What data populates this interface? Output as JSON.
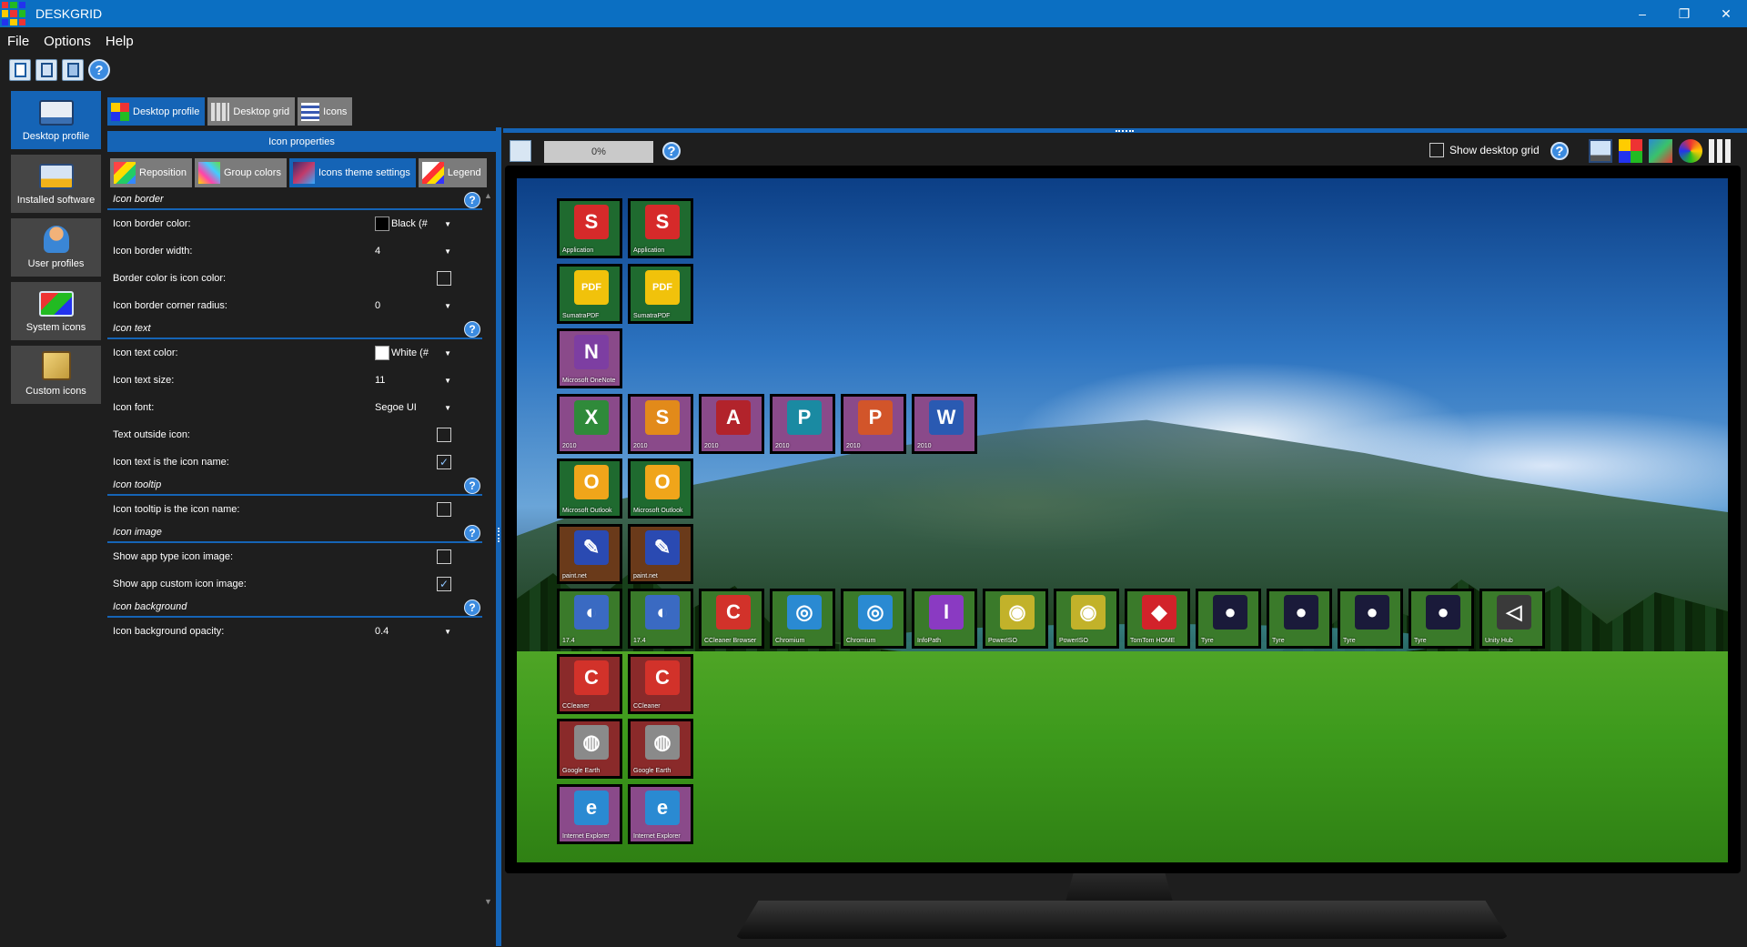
{
  "window": {
    "title": "DESKGRID",
    "controls": {
      "minimize": "–",
      "restore": "❐",
      "close": "✕"
    }
  },
  "menu": [
    "File",
    "Options",
    "Help"
  ],
  "toolbar": {
    "buttons": [
      "new-file-icon",
      "save-icon",
      "save-as-icon",
      "help-icon"
    ],
    "help_glyph": "?"
  },
  "nav": [
    {
      "label": "Desktop profile",
      "icon": "monitor-icon",
      "active": true
    },
    {
      "label": "Installed software",
      "icon": "software-icon",
      "active": false
    },
    {
      "label": "User profiles",
      "icon": "user-icon",
      "active": false
    },
    {
      "label": "System icons",
      "icon": "system-icon",
      "active": false
    },
    {
      "label": "Custom icons",
      "icon": "package-icon",
      "active": false
    }
  ],
  "main_tabs": [
    {
      "label": "Desktop profile",
      "active": true
    },
    {
      "label": "Desktop grid",
      "active": false
    },
    {
      "label": "Icons",
      "active": false
    }
  ],
  "props_header": "Icon properties",
  "sub_tabs": [
    {
      "label": "Reposition",
      "active": false
    },
    {
      "label": "Group colors",
      "active": false
    },
    {
      "label": "Icons theme settings",
      "active": true
    },
    {
      "label": "Legend",
      "active": false
    }
  ],
  "help_glyph": "?",
  "sections": {
    "border": "Icon border",
    "text": "Icon text",
    "tooltip": "Icon tooltip",
    "image": "Icon image",
    "background": "Icon background"
  },
  "props": {
    "border_color": {
      "label": "Icon border color:",
      "value": "Black (#"
    },
    "border_width": {
      "label": "Icon border width:",
      "value": "4"
    },
    "border_is_icon_color": {
      "label": "Border color is icon color:",
      "checked": false
    },
    "corner_radius": {
      "label": "Icon border corner radius:",
      "value": "0"
    },
    "text_color": {
      "label": "Icon text color:",
      "value": "White (#"
    },
    "text_size": {
      "label": "Icon text size:",
      "value": "11"
    },
    "font": {
      "label": "Icon font:",
      "value": "Segoe UI"
    },
    "text_outside": {
      "label": "Text outside icon:",
      "checked": false
    },
    "text_is_name": {
      "label": "Icon text is the icon name:",
      "checked": true
    },
    "tooltip_is_name": {
      "label": "Icon tooltip is the icon name:",
      "checked": false
    },
    "app_type_image": {
      "label": "Show app type icon image:",
      "checked": false
    },
    "custom_image": {
      "label": "Show app custom icon image:",
      "checked": true
    },
    "bg_opacity": {
      "label": "Icon background opacity:",
      "value": "0.4"
    }
  },
  "dropdown_arrow": "▼",
  "check_glyph": "✓",
  "right_panel": {
    "progress": "0%",
    "show_grid_label": "Show desktop grid",
    "show_grid_checked": false,
    "tool_icons": [
      "monitor-view-icon",
      "color-grid-icon",
      "shuffle-icon",
      "color-wheel-icon",
      "grid-icon"
    ]
  },
  "desktop_icons": [
    {
      "label": "Application",
      "glyph": "S",
      "color": "#d62a2a",
      "bg": "#1f6a2f"
    },
    {
      "label": "Application",
      "glyph": "S",
      "color": "#d62a2a",
      "bg": "#1f6a2f"
    },
    {
      "label": "SumatraPDF",
      "glyph": "PDF",
      "color": "#f1c20b",
      "bg": "#1f6a2f"
    },
    {
      "label": "SumatraPDF",
      "glyph": "PDF",
      "color": "#f1c20b",
      "bg": "#1f6a2f"
    },
    {
      "label": "Microsoft OneNote",
      "glyph": "N",
      "color": "#7d3ea2",
      "bg": "#8a4a8a"
    },
    {
      "label": "2010",
      "glyph": "X",
      "color": "#2f8a3a",
      "bg": "#8a4a8a"
    },
    {
      "label": "2010",
      "glyph": "S",
      "color": "#e28a1a",
      "bg": "#8a4a8a"
    },
    {
      "label": "2010",
      "glyph": "A",
      "color": "#b2232b",
      "bg": "#8a4a8a"
    },
    {
      "label": "2010",
      "glyph": "P",
      "color": "#1a8aa2",
      "bg": "#8a4a8a"
    },
    {
      "label": "2010",
      "glyph": "P",
      "color": "#d2552a",
      "bg": "#8a4a8a"
    },
    {
      "label": "2010",
      "glyph": "W",
      "color": "#2a5ab2",
      "bg": "#8a4a8a"
    },
    {
      "label": "Microsoft Outlook",
      "glyph": "O",
      "color": "#f0a51a",
      "bg": "#1f6a2f"
    },
    {
      "label": "Microsoft Outlook",
      "glyph": "O",
      "color": "#f0a51a",
      "bg": "#1f6a2f"
    },
    {
      "label": "paint.net",
      "glyph": "✎",
      "color": "#2a4ab2",
      "bg": "#6a3a1a"
    },
    {
      "label": "paint.net",
      "glyph": "✎",
      "color": "#2a4ab2",
      "bg": "#6a3a1a"
    },
    {
      "label": "17.4",
      "glyph": "◐",
      "color": "#3a6ac2",
      "bg": "#3a7a2a"
    },
    {
      "label": "17.4",
      "glyph": "◐",
      "color": "#3a6ac2",
      "bg": "#3a7a2a"
    },
    {
      "label": "CCleaner Browser",
      "glyph": "C",
      "color": "#d2322a",
      "bg": "#3a7a2a"
    },
    {
      "label": "Chromium",
      "glyph": "◎",
      "color": "#2a8ad2",
      "bg": "#3a7a2a"
    },
    {
      "label": "Chromium",
      "glyph": "◎",
      "color": "#2a8ad2",
      "bg": "#3a7a2a"
    },
    {
      "label": "InfoPath",
      "glyph": "I",
      "color": "#8a3ac2",
      "bg": "#3a7a2a"
    },
    {
      "label": "PowerISO",
      "glyph": "◉",
      "color": "#c2b22a",
      "bg": "#3a7a2a"
    },
    {
      "label": "PowerISO",
      "glyph": "◉",
      "color": "#c2b22a",
      "bg": "#3a7a2a"
    },
    {
      "label": "TomTom HOME",
      "glyph": "◆",
      "color": "#d2222a",
      "bg": "#3a7a2a"
    },
    {
      "label": "Tyre",
      "glyph": "●",
      "color": "#1a1a3a",
      "bg": "#3a7a2a"
    },
    {
      "label": "Tyre",
      "glyph": "●",
      "color": "#1a1a3a",
      "bg": "#3a7a2a"
    },
    {
      "label": "Tyre",
      "glyph": "●",
      "color": "#1a1a3a",
      "bg": "#3a7a2a"
    },
    {
      "label": "Tyre",
      "glyph": "●",
      "color": "#1a1a3a",
      "bg": "#3a7a2a"
    },
    {
      "label": "Unity Hub",
      "glyph": "◁",
      "color": "#3a3a3a",
      "bg": "#3a7a2a"
    },
    {
      "label": "CCleaner",
      "glyph": "C",
      "color": "#d2322a",
      "bg": "#8a2a2a"
    },
    {
      "label": "CCleaner",
      "glyph": "C",
      "color": "#d2322a",
      "bg": "#8a2a2a"
    },
    {
      "label": "Google Earth",
      "glyph": "◍",
      "color": "#8a8a8a",
      "bg": "#8a2a2a"
    },
    {
      "label": "Google Earth",
      "glyph": "◍",
      "color": "#8a8a8a",
      "bg": "#8a2a2a"
    },
    {
      "label": "Internet Explorer",
      "glyph": "e",
      "color": "#2a8ad2",
      "bg": "#8a4a8a"
    },
    {
      "label": "Internet Explorer",
      "glyph": "e",
      "color": "#2a8ad2",
      "bg": "#8a4a8a"
    }
  ]
}
